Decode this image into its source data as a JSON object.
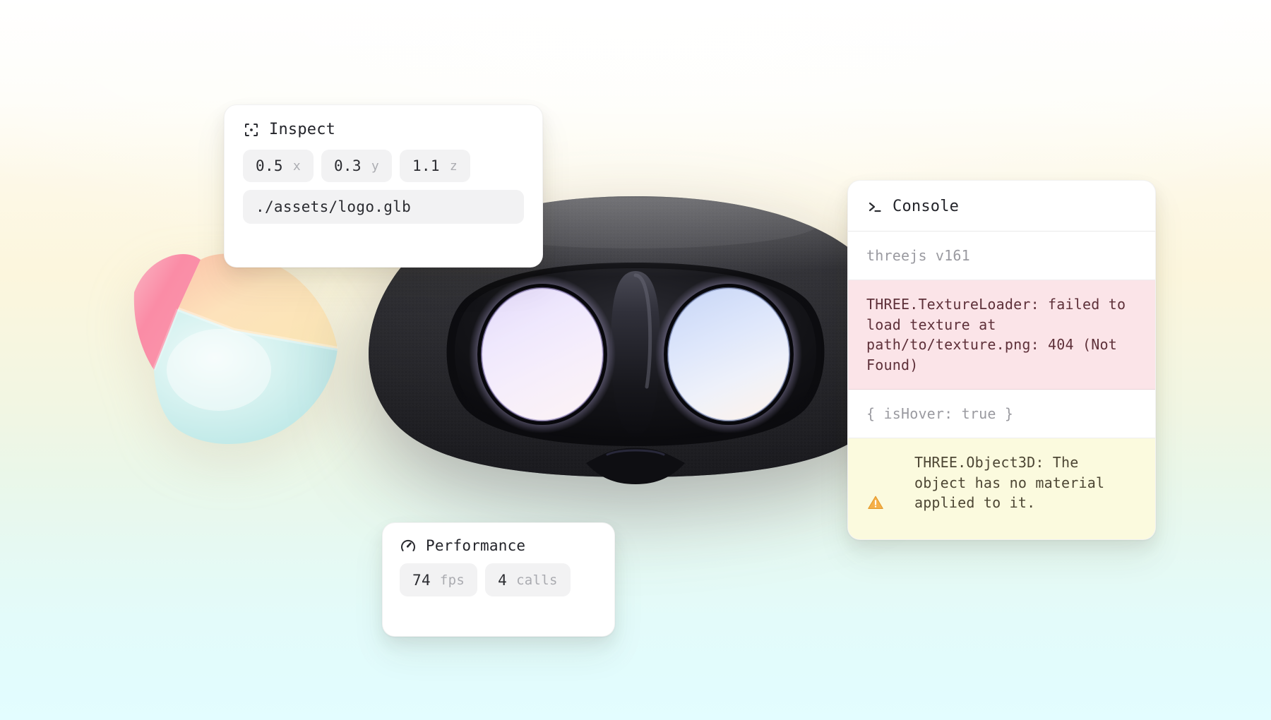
{
  "scene": {
    "background_colors": [
      "#ffffff",
      "#fdf8e6",
      "#f1f6e3",
      "#e3fdff"
    ],
    "objects": [
      {
        "name": "tetra-blob",
        "face_colors": [
          "#f9889f",
          "#fbd9a8",
          "#bfeae8"
        ]
      },
      {
        "name": "vr-headset",
        "body_color": "#1c1c20",
        "lens_left_color": "#ece6fb",
        "lens_right_color": "#dde6fb"
      }
    ]
  },
  "inspect": {
    "icon": "scan-crosshair-icon",
    "title": "Inspect",
    "fields": [
      {
        "value": "0.5",
        "label": "x"
      },
      {
        "value": "0.3",
        "label": "y"
      },
      {
        "value": "1.1",
        "label": "z"
      }
    ],
    "path": "./assets/logo.glb"
  },
  "performance": {
    "icon": "gauge-icon",
    "title": "Performance",
    "stats": [
      {
        "value": "74",
        "label": "fps"
      },
      {
        "value": "4",
        "label": "calls"
      }
    ]
  },
  "console": {
    "icon": "terminal-prompt-icon",
    "title": "Console",
    "rows": [
      {
        "level": "log",
        "icon": null,
        "text": "threejs v161"
      },
      {
        "level": "error",
        "icon": null,
        "text": "THREE.TextureLoader: failed to load texture at path/to/texture.png: 404 (Not Found)"
      },
      {
        "level": "log",
        "icon": null,
        "text": "{ isHover: true }"
      },
      {
        "level": "warn",
        "icon": "warning-triangle-icon",
        "text": "THREE.Object3D: The object has no material applied to it."
      }
    ],
    "colors": {
      "error_bg": "#fbe4e8",
      "warn_bg": "#fbfade",
      "log_text": "#9a9aa0"
    }
  }
}
